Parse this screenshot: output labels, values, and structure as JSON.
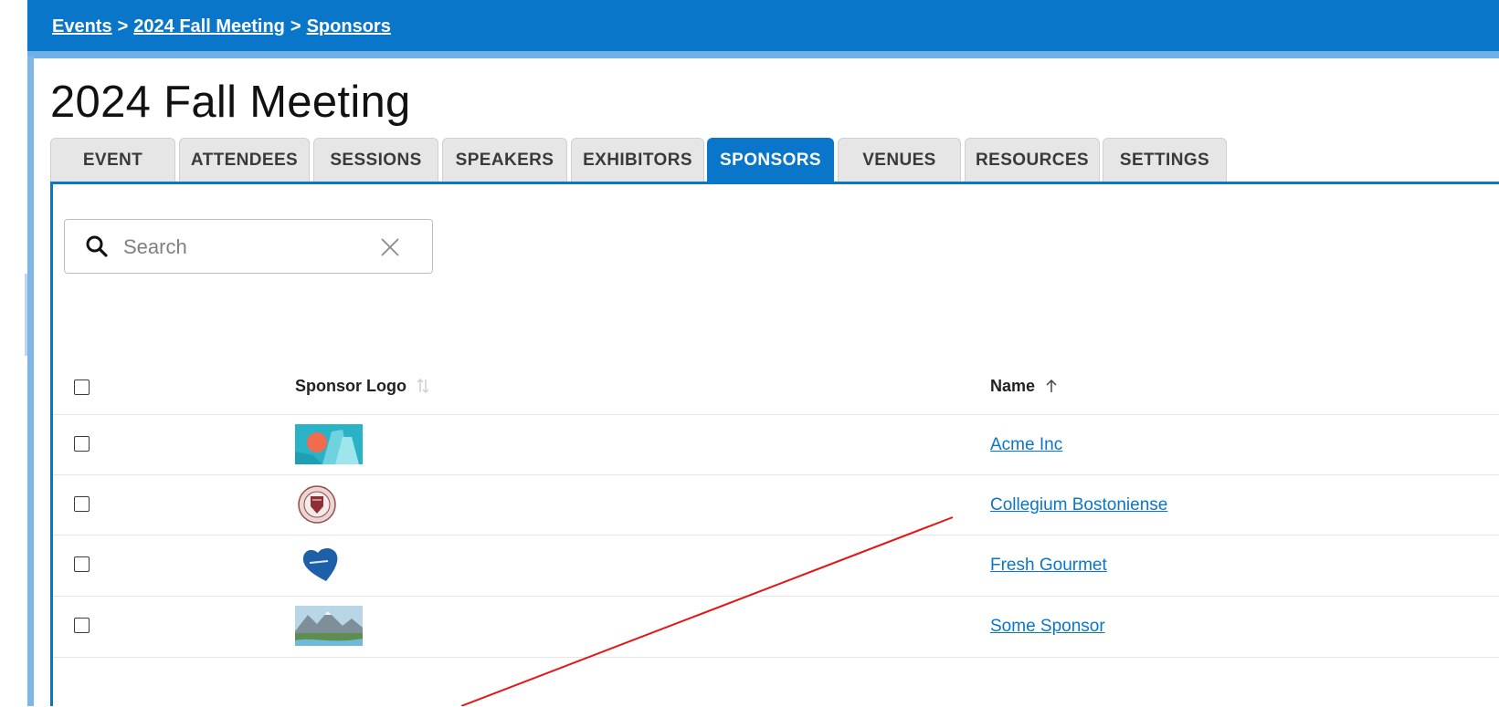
{
  "breadcrumb": {
    "items": [
      "Events",
      "2024 Fall Meeting",
      "Sponsors"
    ],
    "separator": ">"
  },
  "page_title": "2024 Fall Meeting",
  "tabs": [
    {
      "label": "EVENT",
      "active": false
    },
    {
      "label": "ATTENDEES",
      "active": false
    },
    {
      "label": "SESSIONS",
      "active": false
    },
    {
      "label": "SPEAKERS",
      "active": false
    },
    {
      "label": "EXHIBITORS",
      "active": false
    },
    {
      "label": "SPONSORS",
      "active": true
    },
    {
      "label": "VENUES",
      "active": false
    },
    {
      "label": "RESOURCES",
      "active": false
    },
    {
      "label": "SETTINGS",
      "active": false
    }
  ],
  "search": {
    "placeholder": "Search",
    "value": "",
    "icon": "search-icon",
    "clear_icon": "close-icon"
  },
  "table": {
    "columns": [
      {
        "label": "Sponsor Logo",
        "sort_icon": "sort-unsorted-icon"
      },
      {
        "label": "Name",
        "sort_icon": "sort-ascending-icon"
      }
    ],
    "rows": [
      {
        "name": "Acme Inc",
        "logo": "acme-logo",
        "checked": false
      },
      {
        "name": "Collegium Bostoniense",
        "logo": "seal-logo",
        "checked": false
      },
      {
        "name": "Fresh Gourmet",
        "logo": "heart-logo",
        "checked": false
      },
      {
        "name": "Some Sponsor",
        "logo": "landscape-logo",
        "checked": false
      }
    ]
  },
  "colors": {
    "accent": "#0a76c9",
    "tab_inactive_bg": "#e6e6e6",
    "annotation_line": "#e01818"
  }
}
